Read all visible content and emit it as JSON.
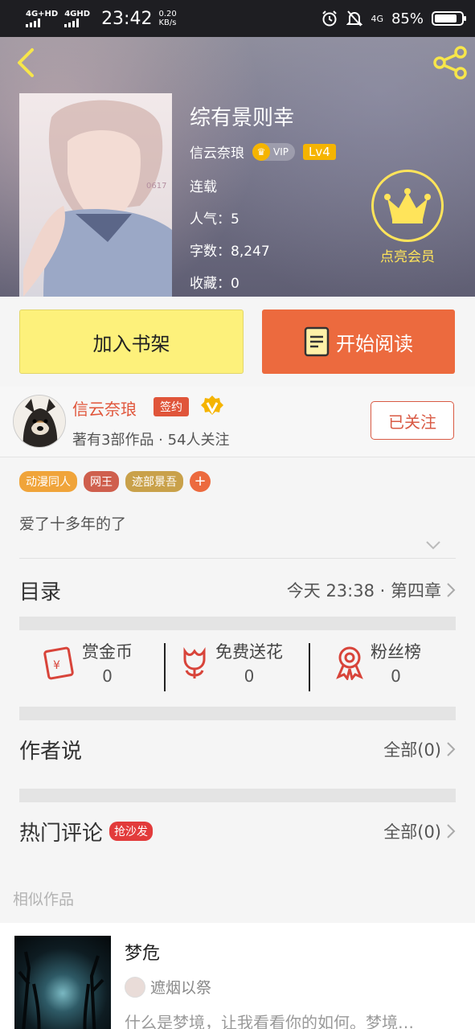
{
  "status_bar": {
    "net1": "4G+HD",
    "net2": "4GHD",
    "time": "23:42",
    "speed_value": "0.20",
    "speed_unit": "KB/s",
    "net3": "4G",
    "battery": "85%",
    "battery_level": 0.85
  },
  "book": {
    "title": "综有景则幸",
    "author": "信云奈琅",
    "vip_label": "VIP",
    "level": "Lv4",
    "status": "连载",
    "popularity": "人气：5",
    "word_count": "字数：8,247",
    "favorites": "收藏：0",
    "cover_watermark": "0617"
  },
  "member": {
    "label": "点亮会员"
  },
  "actions": {
    "add_shelf": "加入书架",
    "start_reading": "开始阅读"
  },
  "author_info": {
    "name": "信云奈琅",
    "sign_tag": "签约",
    "desc": "著有3部作品 · 54人关注",
    "follow_label": "已关注"
  },
  "tags": [
    {
      "label": "动漫同人",
      "color": "#f0a43a"
    },
    {
      "label": "网王",
      "color": "#cf5f4d"
    },
    {
      "label": "迹部景吾",
      "color": "#c9a14a"
    }
  ],
  "tag_add": "+",
  "intro": "爱了十多年的了",
  "catalog": {
    "title": "目录",
    "latest": "今天 23:38 · 第四章"
  },
  "stats": [
    {
      "label": "赏金币",
      "value": "0",
      "icon": "red-envelope-icon"
    },
    {
      "label": "免费送花",
      "value": "0",
      "icon": "flower-icon"
    },
    {
      "label": "粉丝榜",
      "value": "0",
      "icon": "medal-icon"
    }
  ],
  "author_says": {
    "title": "作者说",
    "all": "全部(0)"
  },
  "hot_comments": {
    "title": "热门评论",
    "tag": "抢沙发",
    "all": "全部(0)"
  },
  "similar": {
    "heading": "相似作品",
    "items": [
      {
        "title": "梦危",
        "author": "遮烟以祭",
        "desc": "什么是梦境，让我看看你的如何。梦境…"
      }
    ]
  },
  "colors": {
    "accent": "#ec6a3e",
    "shelf_button": "#fdf17b",
    "member_gold": "#ffe45a",
    "author_red": "#e0553a"
  }
}
